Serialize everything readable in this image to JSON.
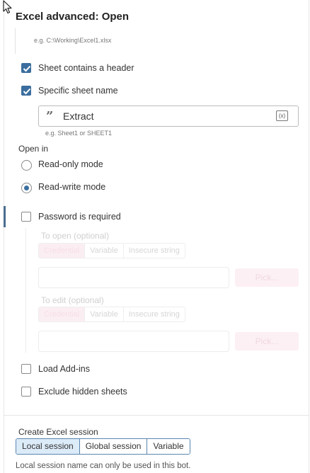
{
  "panel": {
    "title": "Excel advanced: Open",
    "file_hint": "e.g. C:\\Working\\Excel1.xlsx"
  },
  "options": {
    "sheet_header": {
      "label": "Sheet contains a header",
      "checked": true
    },
    "specific_sheet": {
      "label": "Specific sheet name",
      "checked": true
    },
    "sheet_name": {
      "value": "Extract",
      "hint": "e.g. Sheet1 or SHEET1",
      "var_button": "(x)"
    }
  },
  "open_in": {
    "label": "Open in",
    "options": [
      {
        "label": "Read-only mode",
        "selected": false
      },
      {
        "label": "Read-write mode",
        "selected": true
      }
    ]
  },
  "password": {
    "label": "Password is required",
    "checked": false,
    "to_open": {
      "label": "To open (optional)",
      "tabs": [
        "Credential",
        "Variable",
        "Insecure string"
      ],
      "pick_label": "Pick..."
    },
    "to_edit": {
      "label": "To edit (optional)",
      "tabs": [
        "Credential",
        "Variable",
        "Insecure string"
      ],
      "pick_label": "Pick..."
    }
  },
  "load_addins": {
    "label": "Load Add-ins",
    "checked": false
  },
  "exclude_hidden": {
    "label": "Exclude hidden sheets",
    "checked": false
  },
  "session": {
    "label": "Create Excel session",
    "tabs": [
      "Local session",
      "Global session",
      "Variable"
    ],
    "active": "Local session",
    "footnote": "Local session name can only be used in this bot."
  },
  "colors": {
    "accent": "#3b6e9e",
    "disabled_pink": "#fbeef2"
  },
  "icons": [
    "mouse-cursor-icon",
    "checkmark-icon",
    "quote-icon",
    "variable-icon"
  ]
}
